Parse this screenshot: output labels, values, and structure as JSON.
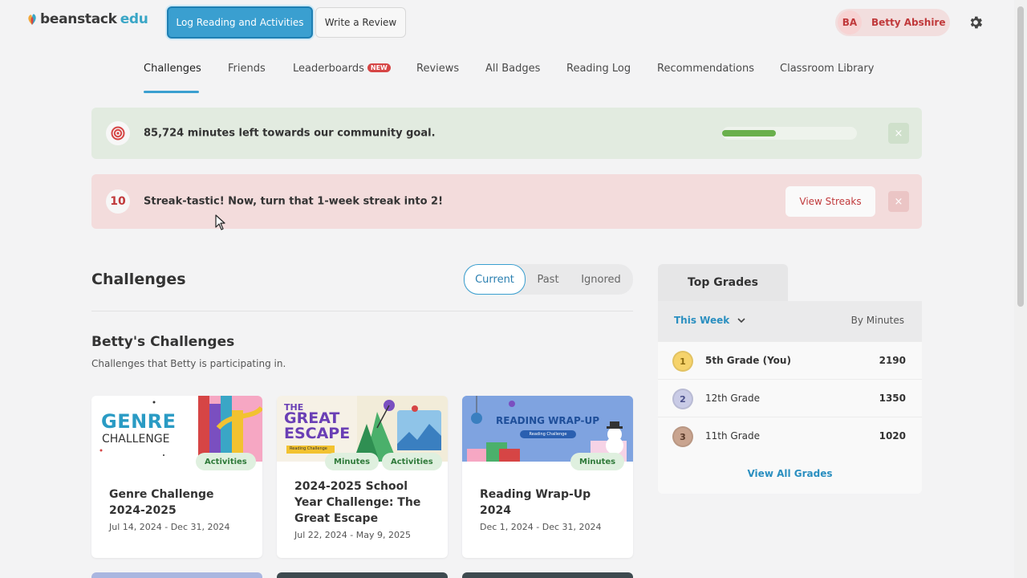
{
  "header": {
    "logo_main": "beanstack",
    "logo_suffix": "edu",
    "log_button": "Log Reading and Activities",
    "review_button": "Write a Review",
    "user_initials": "BA",
    "user_name": "Betty Abshire",
    "settings_icon": "gear-icon"
  },
  "nav": {
    "items": [
      {
        "label": "Challenges",
        "active": true
      },
      {
        "label": "Friends"
      },
      {
        "label": "Leaderboards",
        "badge": "NEW"
      },
      {
        "label": "Reviews"
      },
      {
        "label": "All Badges"
      },
      {
        "label": "Reading Log"
      },
      {
        "label": "Recommendations"
      },
      {
        "label": "Classroom Library"
      }
    ]
  },
  "banners": {
    "goal": {
      "text": "85,724 minutes left towards our community goal.",
      "icon": "target-icon",
      "progress": 0.4,
      "close": "×"
    },
    "streak": {
      "number": "10",
      "text": "Streak-tastic! Now, turn that 1-week streak into 2!",
      "button": "View Streaks",
      "close": "×"
    }
  },
  "challenges": {
    "title": "Challenges",
    "filters": [
      "Current",
      "Past",
      "Ignored"
    ],
    "active_filter": "Current",
    "subtitle": "Betty's Challenges",
    "description": "Challenges that Betty is participating in.",
    "cards": [
      {
        "image_title_1": "GENRE",
        "image_title_2": "CHALLENGE",
        "tags": [
          "Activities"
        ],
        "title": "Genre Challenge 2024-2025",
        "dates": "Jul 14, 2024 - Dec 31, 2024"
      },
      {
        "image_title_1": "THE",
        "image_title_2": "GREAT",
        "image_title_3": "ESCAPE",
        "image_caption": "Reading Challenge",
        "tags": [
          "Minutes",
          "Activities"
        ],
        "title": "2024-2025 School Year Challenge: The Great Escape",
        "dates": "Jul 22, 2024 - May 9, 2025"
      },
      {
        "image_title_1": "READING WRAP-UP",
        "image_caption": "Reading Challenge",
        "tags": [
          "Minutes"
        ],
        "title": "Reading Wrap-Up 2024",
        "dates": "Dec 1, 2024 - Dec 31, 2024"
      }
    ]
  },
  "top_grades": {
    "title": "Top Grades",
    "period": "This Week",
    "metric": "By Minutes",
    "rows": [
      {
        "rank": "1",
        "name": "5th Grade (You)",
        "value": "2190",
        "color": "#f6d36b"
      },
      {
        "rank": "2",
        "name": "12th Grade",
        "value": "1350",
        "color": "#c9cbe6"
      },
      {
        "rank": "3",
        "name": "11th Grade",
        "value": "1020",
        "color": "#c9a48f"
      }
    ],
    "view_all": "View All Grades"
  }
}
